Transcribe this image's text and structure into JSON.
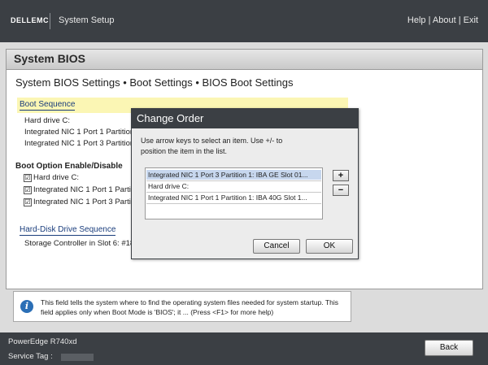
{
  "header": {
    "logo": "DELLEMC",
    "app_title": "System Setup",
    "links": [
      "Help",
      "About",
      "Exit"
    ],
    "link_sep": "|"
  },
  "panel": {
    "title": "System BIOS",
    "breadcrumb": "System BIOS Settings • Boot Settings • BIOS Boot Settings"
  },
  "boot_sequence": {
    "label": "Boot Sequence",
    "items": [
      "Hard drive C:",
      "Integrated NIC 1 Port 1 Partition",
      "Integrated NIC 1 Port 3 Partition"
    ]
  },
  "boot_option": {
    "label": "Boot Option Enable/Disable",
    "items": [
      {
        "label": "Hard drive C:",
        "checked": true
      },
      {
        "label": "Integrated NIC 1 Port 1 Partit",
        "checked": true
      },
      {
        "label": "Integrated NIC 1 Port 3 Partit",
        "checked": true
      }
    ],
    "check_glyph": "☑"
  },
  "hdd_sequence": {
    "label": "Hard-Disk Drive Sequence",
    "item": "Storage Controller in Slot 6: #18"
  },
  "dialog": {
    "title": "Change Order",
    "instructions": "Use arrow keys to select an item. Use +/- to position the item in the list.",
    "items": [
      "Integrated NIC 1 Port 3 Partition 1: IBA GE Slot 01...",
      "Hard drive C:",
      "Integrated NIC 1 Port 1 Partition 1: IBA 40G Slot 1..."
    ],
    "selected_index": 0,
    "plus": "+",
    "minus": "−",
    "cancel": "Cancel",
    "ok": "OK"
  },
  "help": {
    "icon": "i",
    "text": "This field tells the system where to find the operating system files needed for system startup. This field applies only when Boot Mode is 'BIOS'; it ... (Press <F1> for more help)"
  },
  "footer": {
    "model": "PowerEdge R740xd",
    "service_tag_label": "Service Tag :",
    "back": "Back"
  },
  "colors": {
    "topbar": "#3b3f44",
    "highlight": "#fbf6b4",
    "link": "#1a3d7c",
    "selection": "#c7d7ee",
    "info": "#2b6fb6"
  }
}
